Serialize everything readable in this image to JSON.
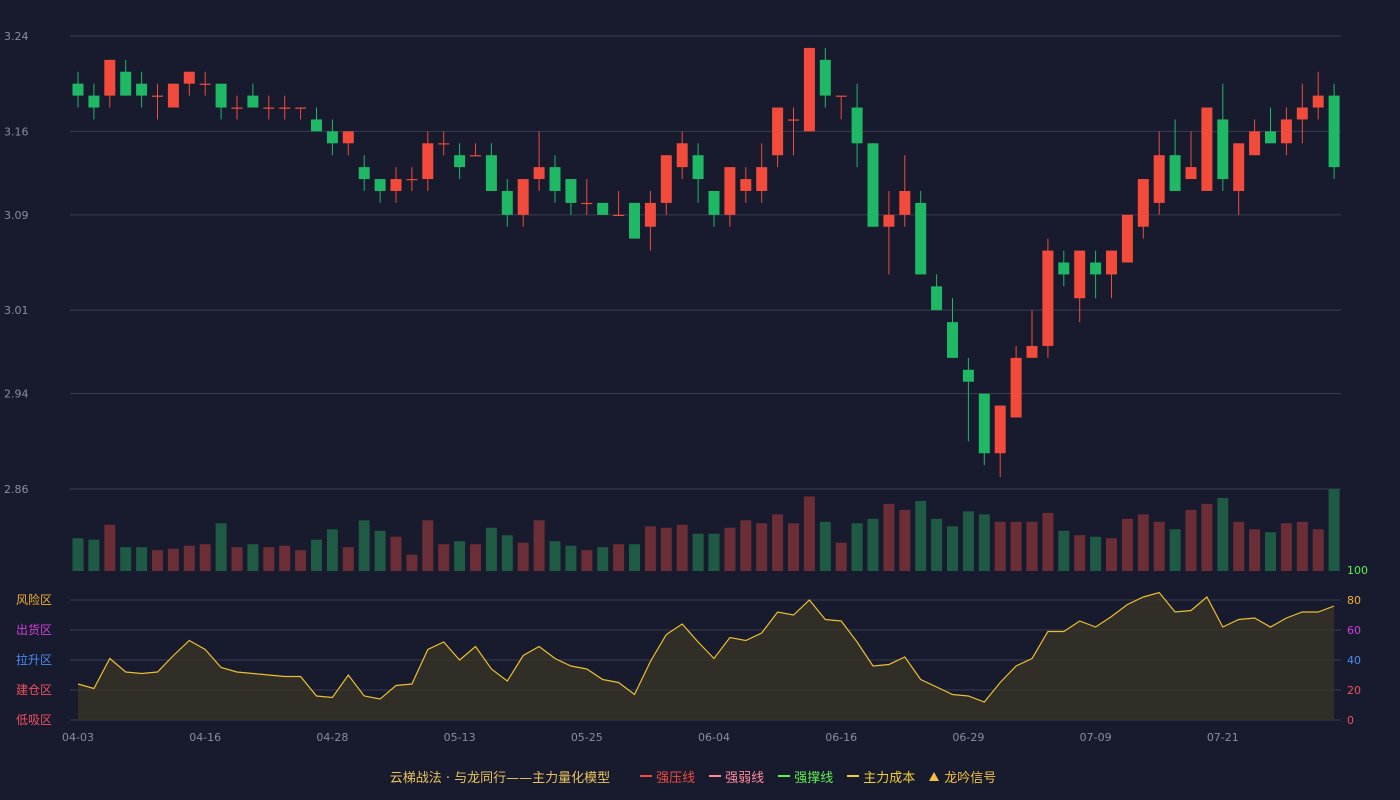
{
  "chart_data": {
    "type": "candlestick",
    "x_tick_labels": [
      "04-03",
      "04-16",
      "04-28",
      "05-13",
      "05-25",
      "06-04",
      "06-16",
      "06-29",
      "07-09",
      "07-21"
    ],
    "x_tick_indices": [
      0,
      8,
      16,
      24,
      32,
      40,
      48,
      56,
      64,
      72
    ],
    "price_axis": {
      "ticks": [
        3.24,
        3.16,
        3.09,
        3.01,
        2.94,
        2.86
      ],
      "range": [
        2.86,
        3.24
      ]
    },
    "candles": [
      [
        3.2,
        3.19,
        3.21,
        3.18
      ],
      [
        3.19,
        3.18,
        3.2,
        3.17
      ],
      [
        3.19,
        3.22,
        3.22,
        3.18
      ],
      [
        3.21,
        3.19,
        3.22,
        3.19
      ],
      [
        3.2,
        3.19,
        3.21,
        3.18
      ],
      [
        3.19,
        3.19,
        3.2,
        3.17
      ],
      [
        3.18,
        3.2,
        3.2,
        3.18
      ],
      [
        3.2,
        3.21,
        3.21,
        3.19
      ],
      [
        3.2,
        3.2,
        3.21,
        3.19
      ],
      [
        3.2,
        3.18,
        3.2,
        3.17
      ],
      [
        3.18,
        3.18,
        3.19,
        3.17
      ],
      [
        3.19,
        3.18,
        3.2,
        3.18
      ],
      [
        3.18,
        3.18,
        3.19,
        3.17
      ],
      [
        3.18,
        3.18,
        3.19,
        3.17
      ],
      [
        3.18,
        3.18,
        3.18,
        3.17
      ],
      [
        3.17,
        3.16,
        3.18,
        3.16
      ],
      [
        3.16,
        3.15,
        3.17,
        3.14
      ],
      [
        3.15,
        3.16,
        3.16,
        3.14
      ],
      [
        3.13,
        3.12,
        3.14,
        3.11
      ],
      [
        3.12,
        3.11,
        3.12,
        3.1
      ],
      [
        3.11,
        3.12,
        3.13,
        3.1
      ],
      [
        3.12,
        3.12,
        3.13,
        3.11
      ],
      [
        3.12,
        3.15,
        3.16,
        3.11
      ],
      [
        3.15,
        3.15,
        3.16,
        3.14
      ],
      [
        3.14,
        3.13,
        3.15,
        3.12
      ],
      [
        3.14,
        3.14,
        3.15,
        3.14
      ],
      [
        3.14,
        3.11,
        3.15,
        3.11
      ],
      [
        3.11,
        3.09,
        3.12,
        3.08
      ],
      [
        3.09,
        3.12,
        3.12,
        3.08
      ],
      [
        3.12,
        3.13,
        3.16,
        3.11
      ],
      [
        3.13,
        3.11,
        3.14,
        3.1
      ],
      [
        3.12,
        3.1,
        3.12,
        3.09
      ],
      [
        3.1,
        3.1,
        3.12,
        3.09
      ],
      [
        3.1,
        3.09,
        3.1,
        3.09
      ],
      [
        3.09,
        3.09,
        3.11,
        3.09
      ],
      [
        3.1,
        3.07,
        3.1,
        3.07
      ],
      [
        3.08,
        3.1,
        3.11,
        3.06
      ],
      [
        3.1,
        3.14,
        3.14,
        3.09
      ],
      [
        3.13,
        3.15,
        3.16,
        3.12
      ],
      [
        3.14,
        3.12,
        3.15,
        3.1
      ],
      [
        3.11,
        3.09,
        3.11,
        3.08
      ],
      [
        3.09,
        3.13,
        3.13,
        3.08
      ],
      [
        3.11,
        3.12,
        3.13,
        3.1
      ],
      [
        3.11,
        3.13,
        3.15,
        3.1
      ],
      [
        3.14,
        3.18,
        3.18,
        3.13
      ],
      [
        3.17,
        3.17,
        3.18,
        3.14
      ],
      [
        3.16,
        3.23,
        3.23,
        3.16
      ],
      [
        3.22,
        3.19,
        3.23,
        3.18
      ],
      [
        3.19,
        3.19,
        3.19,
        3.17
      ],
      [
        3.18,
        3.15,
        3.2,
        3.13
      ],
      [
        3.15,
        3.08,
        3.15,
        3.08
      ],
      [
        3.08,
        3.09,
        3.11,
        3.04
      ],
      [
        3.09,
        3.11,
        3.14,
        3.08
      ],
      [
        3.1,
        3.04,
        3.11,
        3.04
      ],
      [
        3.03,
        3.01,
        3.04,
        3.01
      ],
      [
        3.0,
        2.97,
        3.02,
        2.97
      ],
      [
        2.96,
        2.95,
        2.97,
        2.9
      ],
      [
        2.94,
        2.89,
        2.94,
        2.88
      ],
      [
        2.89,
        2.93,
        2.93,
        2.87
      ],
      [
        2.92,
        2.97,
        2.98,
        2.92
      ],
      [
        2.97,
        2.98,
        3.01,
        2.97
      ],
      [
        2.98,
        3.06,
        3.07,
        2.97
      ],
      [
        3.05,
        3.04,
        3.06,
        3.03
      ],
      [
        3.02,
        3.06,
        3.06,
        3.0
      ],
      [
        3.05,
        3.04,
        3.06,
        3.02
      ],
      [
        3.04,
        3.06,
        3.06,
        3.02
      ],
      [
        3.05,
        3.09,
        3.09,
        3.05
      ],
      [
        3.08,
        3.12,
        3.12,
        3.07
      ],
      [
        3.1,
        3.14,
        3.16,
        3.09
      ],
      [
        3.14,
        3.11,
        3.17,
        3.11
      ],
      [
        3.12,
        3.13,
        3.16,
        3.12
      ],
      [
        3.11,
        3.18,
        3.18,
        3.11
      ],
      [
        3.17,
        3.12,
        3.2,
        3.11
      ],
      [
        3.11,
        3.15,
        3.15,
        3.09
      ],
      [
        3.14,
        3.16,
        3.17,
        3.14
      ],
      [
        3.16,
        3.15,
        3.18,
        3.15
      ],
      [
        3.15,
        3.17,
        3.18,
        3.14
      ],
      [
        3.17,
        3.18,
        3.2,
        3.15
      ],
      [
        3.18,
        3.19,
        3.21,
        3.17
      ],
      [
        3.19,
        3.13,
        3.2,
        3.12
      ]
    ],
    "volume": [
      22,
      21,
      31,
      16,
      16,
      14,
      15,
      17,
      18,
      32,
      16,
      18,
      16,
      17,
      14,
      21,
      28,
      16,
      34,
      27,
      23,
      11,
      34,
      18,
      20,
      18,
      29,
      24,
      19,
      34,
      20,
      17,
      14,
      16,
      18,
      18,
      30,
      29,
      31,
      25,
      25,
      29,
      34,
      32,
      38,
      32,
      50,
      33,
      19,
      32,
      35,
      45,
      41,
      47,
      35,
      30,
      40,
      38,
      33,
      33,
      33,
      39,
      27,
      24,
      23,
      22,
      35,
      38,
      33,
      28,
      41,
      45,
      49,
      33,
      28,
      26,
      32,
      33,
      28,
      55
    ],
    "oscillator": {
      "axis_ticks": [
        0,
        20,
        40,
        60,
        80,
        100
      ],
      "zone_labels": [
        "风险区",
        "出货区",
        "拉升区",
        "建仓区",
        "低吸区"
      ],
      "values": [
        24,
        21,
        41,
        32,
        31,
        32,
        43,
        53,
        47,
        35,
        32,
        31,
        30,
        29,
        29,
        16,
        15,
        30,
        16,
        14,
        23,
        24,
        47,
        52,
        40,
        49,
        34,
        26,
        43,
        49,
        41,
        36,
        34,
        27,
        25,
        17,
        39,
        57,
        64,
        52,
        41,
        55,
        53,
        58,
        72,
        70,
        80,
        67,
        66,
        52,
        36,
        37,
        42,
        27,
        22,
        17,
        16,
        12,
        25,
        36,
        41,
        59,
        59,
        66,
        62,
        69,
        77,
        82,
        85,
        72,
        73,
        82,
        62,
        67,
        68,
        62,
        68,
        72,
        72,
        76
      ]
    },
    "legend_title": "云梯战法 · 与龙同行——主力量化模型",
    "legend": [
      {
        "label": "强压线",
        "color": "#f24b3c",
        "style": "solid"
      },
      {
        "label": "强弱线",
        "color": "#ff8b9a",
        "style": "dashed"
      },
      {
        "label": "强撑线",
        "color": "#5cf04e",
        "style": "solid"
      },
      {
        "label": "主力成本",
        "color": "#f0d030",
        "style": "dashed"
      },
      {
        "label": "龙吟信号",
        "color": "#f0c040",
        "style": "triangle"
      }
    ],
    "colors": {
      "background": "#181a2e",
      "up": "#f24b3c",
      "down": "#1fb865",
      "vol_up": "#6b2e36",
      "vol_down": "#1f5a44",
      "oscillator_line": "#e8c030",
      "grid": "#3a3d52",
      "axis_text": "#8a8d9e"
    },
    "zone_colors": [
      "#f0b030",
      "#d040d8",
      "#4a8cf0",
      "#f05060",
      "#f05060"
    ],
    "osc_tick_colors": [
      "#f05060",
      "#f05060",
      "#4a8cf0",
      "#d040d8",
      "#f0b030",
      "#5cf04e"
    ]
  }
}
